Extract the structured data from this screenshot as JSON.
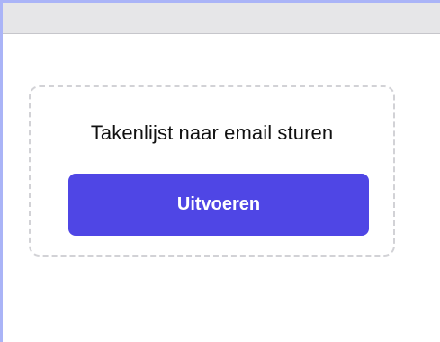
{
  "card": {
    "title": "Takenlijst naar email sturen",
    "button_label": "Uitvoeren"
  },
  "colors": {
    "accent": "#4f46e5",
    "window_border": "#aab4f7",
    "titlebar": "#e6e6e8",
    "card_border": "#d2d2d6"
  }
}
